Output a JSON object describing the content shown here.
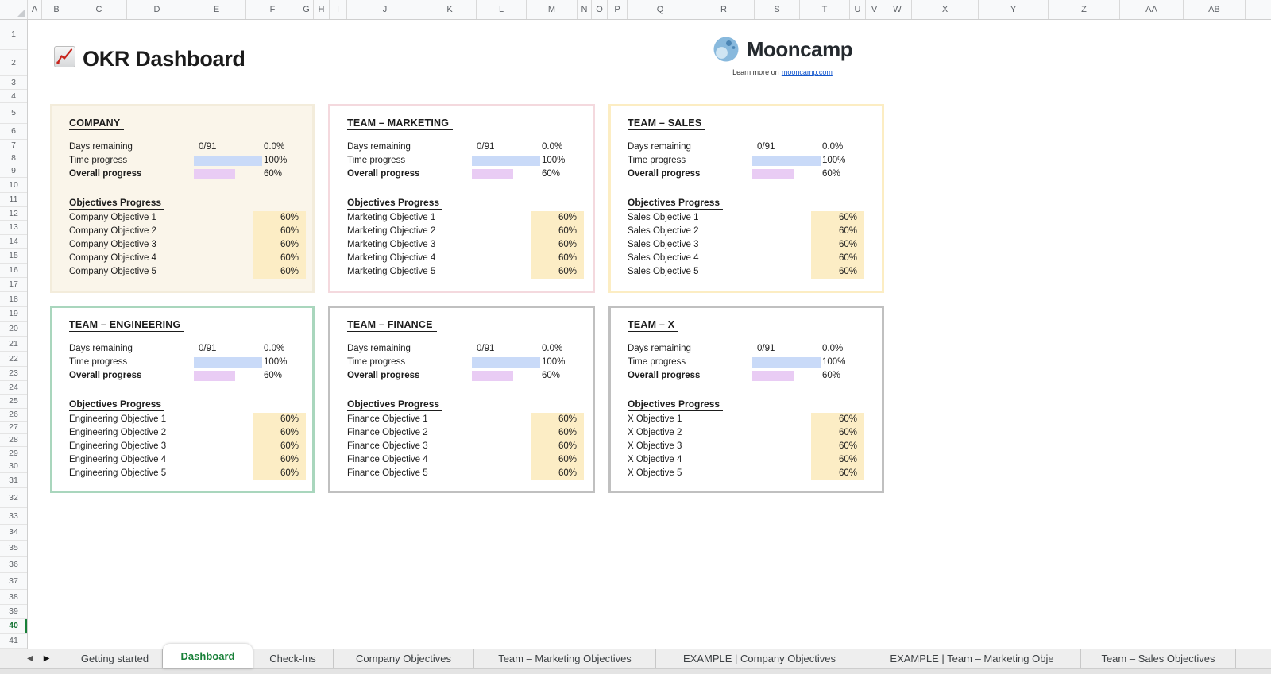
{
  "header": {
    "title": "OKR Dashboard",
    "title_icon": "chart-increasing-icon"
  },
  "brand": {
    "name": "Mooncamp",
    "logo_icon": "moon-logo-icon",
    "tagline_prefix": "Learn more on",
    "tagline_link": "mooncamp.com"
  },
  "spreadsheet": {
    "column_headers": [
      "A",
      "B",
      "C",
      "D",
      "E",
      "F",
      "G",
      "H",
      "I",
      "J",
      "K",
      "L",
      "M",
      "N",
      "O",
      "P",
      "Q",
      "R",
      "S",
      "T",
      "U",
      "V",
      "W",
      "X",
      "Y",
      "Z",
      "AA",
      "AB"
    ],
    "row_count": 41,
    "selected_row": 40
  },
  "card_labels": {
    "days": "Days remaining",
    "time": "Time progress",
    "overall": "Overall progress",
    "objectives_heading": "Objectives Progress"
  },
  "cards": [
    {
      "title": "COMPANY",
      "days_value": "0/91",
      "days_pct": "0.0%",
      "time_pct": "100%",
      "time_bar_pct": 100,
      "overall_pct": "60%",
      "overall_bar_pct": 60,
      "objectives": [
        {
          "name": "Company Objective 1",
          "pct": "60%"
        },
        {
          "name": "Company Objective 2",
          "pct": "60%"
        },
        {
          "name": "Company Objective 3",
          "pct": "60%"
        },
        {
          "name": "Company Objective 4",
          "pct": "60%"
        },
        {
          "name": "Company Objective 5",
          "pct": "60%"
        }
      ],
      "style": {
        "bg": "#faf5ea",
        "border": "#f3ecdb"
      }
    },
    {
      "title": "TEAM – MARKETING",
      "days_value": "0/91",
      "days_pct": "0.0%",
      "time_pct": "100%",
      "time_bar_pct": 100,
      "overall_pct": "60%",
      "overall_bar_pct": 60,
      "objectives": [
        {
          "name": "Marketing Objective 1",
          "pct": "60%"
        },
        {
          "name": "Marketing Objective 2",
          "pct": "60%"
        },
        {
          "name": "Marketing Objective 3",
          "pct": "60%"
        },
        {
          "name": "Marketing Objective 4",
          "pct": "60%"
        },
        {
          "name": "Marketing Objective 5",
          "pct": "60%"
        }
      ],
      "style": {
        "bg": "#ffffff",
        "border": "#f4d9de"
      }
    },
    {
      "title": "TEAM – SALES",
      "days_value": "0/91",
      "days_pct": "0.0%",
      "time_pct": "100%",
      "time_bar_pct": 100,
      "overall_pct": "60%",
      "overall_bar_pct": 60,
      "objectives": [
        {
          "name": "Sales Objective 1",
          "pct": "60%"
        },
        {
          "name": "Sales Objective 2",
          "pct": "60%"
        },
        {
          "name": "Sales Objective 3",
          "pct": "60%"
        },
        {
          "name": "Sales Objective 4",
          "pct": "60%"
        },
        {
          "name": "Sales Objective 5",
          "pct": "60%"
        }
      ],
      "style": {
        "bg": "#ffffff",
        "border": "#fcedc3"
      }
    },
    {
      "title": "TEAM – ENGINEERING",
      "days_value": "0/91",
      "days_pct": "0.0%",
      "time_pct": "100%",
      "time_bar_pct": 100,
      "overall_pct": "60%",
      "overall_bar_pct": 60,
      "objectives": [
        {
          "name": "Engineering Objective 1",
          "pct": "60%"
        },
        {
          "name": "Engineering Objective 2",
          "pct": "60%"
        },
        {
          "name": "Engineering Objective 3",
          "pct": "60%"
        },
        {
          "name": "Engineering Objective 4",
          "pct": "60%"
        },
        {
          "name": "Engineering Objective 5",
          "pct": "60%"
        }
      ],
      "style": {
        "bg": "#ffffff",
        "border": "#a9d6bd"
      }
    },
    {
      "title": "TEAM – FINANCE",
      "days_value": "0/91",
      "days_pct": "0.0%",
      "time_pct": "100%",
      "time_bar_pct": 100,
      "overall_pct": "60%",
      "overall_bar_pct": 60,
      "objectives": [
        {
          "name": "Finance Objective 1",
          "pct": "60%"
        },
        {
          "name": "Finance Objective 2",
          "pct": "60%"
        },
        {
          "name": "Finance Objective 3",
          "pct": "60%"
        },
        {
          "name": "Finance Objective 4",
          "pct": "60%"
        },
        {
          "name": "Finance Objective 5",
          "pct": "60%"
        }
      ],
      "style": {
        "bg": "#ffffff",
        "border": "#c0c0c0"
      }
    },
    {
      "title": "TEAM – X",
      "days_value": "0/91",
      "days_pct": "0.0%",
      "time_pct": "100%",
      "time_bar_pct": 100,
      "overall_pct": "60%",
      "overall_bar_pct": 60,
      "objectives": [
        {
          "name": "X Objective 1",
          "pct": "60%"
        },
        {
          "name": "X Objective 2",
          "pct": "60%"
        },
        {
          "name": "X Objective 3",
          "pct": "60%"
        },
        {
          "name": "X Objective 4",
          "pct": "60%"
        },
        {
          "name": "X Objective 5",
          "pct": "60%"
        }
      ],
      "style": {
        "bg": "#ffffff",
        "border": "#c0c0c0"
      }
    }
  ],
  "tabbar": {
    "tabs": [
      {
        "label": "Getting started",
        "active": false
      },
      {
        "label": "Dashboard",
        "active": true
      },
      {
        "label": "Check-Ins",
        "active": false
      },
      {
        "label": "Company Objectives",
        "active": false
      },
      {
        "label": "Team – Marketing Objectives",
        "active": false
      },
      {
        "label": "EXAMPLE | Company Objectives",
        "active": false
      },
      {
        "label": "EXAMPLE | Team – Marketing Obje",
        "active": false
      },
      {
        "label": "Team – Sales Objectives",
        "active": false
      }
    ]
  },
  "colors": {
    "time_bar": "#c9daf8",
    "overall_bar": "#e9ccf4",
    "objective_cell": "#fcedc5",
    "active_tab_text": "#188038",
    "selected_row_text": "#137333",
    "link": "#1155cc"
  }
}
